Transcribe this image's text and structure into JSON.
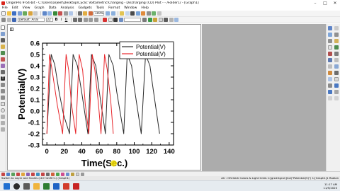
{
  "window": {
    "title": "OriginPro 9 64-bit - C:\\Users\\arjeet\\Desktop\\Cyclic Voltametric\\Charging - Discharging (CD) Plot - - /Folder1/ - [Graph1]",
    "minimize_icon": "minimize-icon",
    "maximize_icon": "maximize-icon",
    "close_icon": "close-icon"
  },
  "menu": [
    "File",
    "Edit",
    "View",
    "Graph",
    "Data",
    "Analysis",
    "Gadgets",
    "Tools",
    "Format",
    "Window",
    "Help"
  ],
  "toolbar": {
    "zoom": "100%",
    "font_name": "Default: Arial",
    "font_size": "22",
    "bold_label": "B",
    "italic_label": "I",
    "underline_label": "U"
  },
  "graph_window": {
    "layer_number": "1"
  },
  "status": {
    "left": "Switch to Layer and Scales (ctrl+shift+L) (Graph1)",
    "right": "AU : ON  Dark Colors & Light Grids  1:[gra1Ggra1]Col(\"Potential(V)\")  1:[Graph1]1  Radian"
  },
  "clock": {
    "time": "11:17 AM",
    "date": "11/5/2020"
  },
  "colors": {
    "series_black": "#2a2a2a",
    "series_red": "#e8262b",
    "gray_panel": "#acacac",
    "cursor_highlight": "#f2dd00"
  },
  "chart_data": {
    "type": "line",
    "xlabel": "Time(Sec.)",
    "ylabel": "Potential(V)",
    "xlim": [
      -5,
      145
    ],
    "ylim": [
      -0.3,
      0.6
    ],
    "xticks": [
      0,
      20,
      40,
      60,
      80,
      100,
      120,
      140
    ],
    "yticks": [
      -0.3,
      -0.2,
      -0.1,
      0.0,
      0.1,
      0.2,
      0.3,
      0.4,
      0.5,
      0.6
    ],
    "tick_labels_x": [
      "0",
      "20",
      "40",
      "60",
      "80",
      "100",
      "120",
      "140"
    ],
    "tick_labels_y": [
      "-0.3",
      "-0.2",
      "-0.1",
      "0.0",
      "0.1",
      "0.2",
      "0.3",
      "0.4",
      "0.5",
      "0.6"
    ],
    "legend_position": "top-right",
    "series": [
      {
        "name": "Potential(V)",
        "color": "#2a2a2a",
        "x": [
          0,
          5,
          9,
          14,
          19,
          26,
          30,
          35,
          40,
          47,
          51,
          56,
          60,
          67,
          71,
          76,
          80,
          88,
          92,
          97,
          100,
          108,
          113,
          118,
          121,
          129
        ],
        "y": [
          -0.2,
          0.5,
          0.41,
          0.17,
          -0.03,
          -0.2,
          0.5,
          0.4,
          0.16,
          -0.2,
          0.5,
          0.4,
          0.17,
          -0.2,
          0.5,
          0.4,
          0.17,
          -0.2,
          0.5,
          0.4,
          0.21,
          -0.2,
          0.5,
          0.4,
          0.23,
          -0.2
        ]
      },
      {
        "name": "Potential(V)",
        "color": "#e8262b",
        "x": [
          0,
          3,
          6,
          12,
          18,
          22,
          25,
          28,
          33,
          37,
          41,
          44,
          48,
          52,
          55,
          59,
          62,
          66,
          69,
          73,
          76
        ],
        "y": [
          -0.2,
          0.5,
          0.36,
          0.05,
          -0.2,
          0.5,
          0.36,
          0.07,
          -0.2,
          0.5,
          0.36,
          0.06,
          -0.2,
          0.5,
          0.36,
          0.07,
          -0.2,
          0.5,
          0.37,
          0.1,
          -0.2
        ]
      }
    ]
  }
}
